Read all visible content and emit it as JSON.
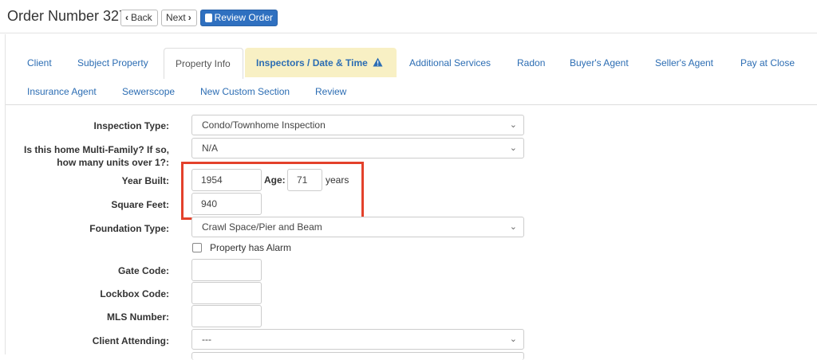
{
  "header": {
    "title": "Order Number 327",
    "back_label": "Back",
    "next_label": "Next",
    "review_label": "Review Order"
  },
  "tabs_row1": [
    {
      "label": "Client"
    },
    {
      "label": "Subject Property"
    },
    {
      "label": "Property Info"
    },
    {
      "label": "Inspectors / Date & Time"
    },
    {
      "label": "Additional Services"
    },
    {
      "label": "Radon"
    },
    {
      "label": "Buyer's Agent"
    },
    {
      "label": "Seller's Agent"
    },
    {
      "label": "Pay at Close"
    }
  ],
  "tabs_row2": [
    {
      "label": "Insurance Agent"
    },
    {
      "label": "Sewerscope"
    },
    {
      "label": "New Custom Section"
    },
    {
      "label": "Review"
    }
  ],
  "active_tab": "Property Info",
  "warning_tab": "Inspectors / Date & Time",
  "form": {
    "inspection_type": {
      "label": "Inspection Type:",
      "value": "Condo/Townhome Inspection"
    },
    "multi_family": {
      "label_line1": "Is this home Multi-Family? If so,",
      "label_line2": "how many units over 1?:",
      "value": "N/A"
    },
    "year_built": {
      "label": "Year Built:",
      "value": "1954"
    },
    "age": {
      "label": "Age:",
      "value": "71",
      "unit": "years"
    },
    "square_feet": {
      "label": "Square Feet:",
      "value": "940"
    },
    "foundation_type": {
      "label": "Foundation Type:",
      "value": "Crawl Space/Pier and Beam"
    },
    "alarm": {
      "label": "Property has Alarm",
      "checked": false
    },
    "gate_code": {
      "label": "Gate Code:",
      "value": ""
    },
    "lockbox_code": {
      "label": "Lockbox Code:",
      "value": ""
    },
    "mls_number": {
      "label": "MLS Number:",
      "value": ""
    },
    "client_attending": {
      "label": "Client Attending:",
      "value": "---"
    }
  },
  "colors": {
    "link": "#2c6db3",
    "primary_button": "#2f70c0",
    "warning_tab_bg": "#f8f0c4",
    "highlight_box": "#e3412b"
  }
}
